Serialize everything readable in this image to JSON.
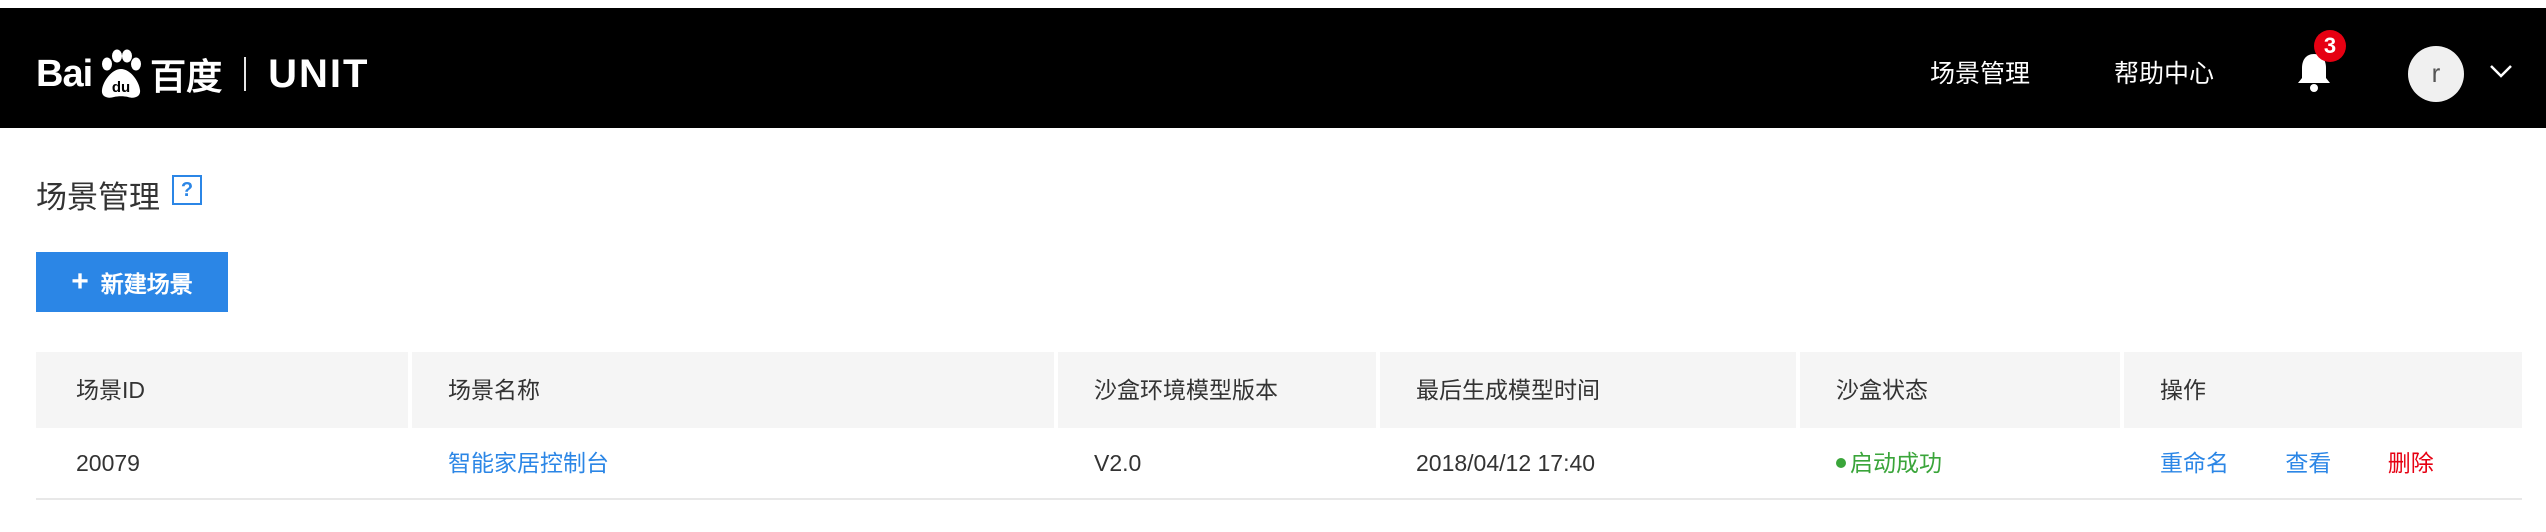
{
  "header": {
    "logo": {
      "bai": "Bai",
      "du": "du",
      "cn": "百度",
      "product": "UNIT"
    },
    "nav": [
      "场景管理",
      "帮助中心"
    ],
    "notification_count": "3",
    "avatar_letter": "r"
  },
  "page": {
    "title": "场景管理",
    "help_glyph": "?",
    "new_button": {
      "icon": "+",
      "label": "新建场景"
    }
  },
  "table": {
    "columns": [
      "场景ID",
      "场景名称",
      "沙盒环境模型版本",
      "最后生成模型时间",
      "沙盒状态",
      "操作"
    ],
    "rows": [
      {
        "id": "20079",
        "name": "智能家居控制台",
        "version": "V2.0",
        "time": "2018/04/12 17:40",
        "status": "启动成功",
        "actions": [
          "重命名",
          "查看",
          "删除"
        ]
      }
    ]
  },
  "colors": {
    "navbar": "#000000",
    "accent": "#2b86e6",
    "success": "#3aa53a",
    "danger": "#e60012",
    "badge": "#e60012"
  }
}
